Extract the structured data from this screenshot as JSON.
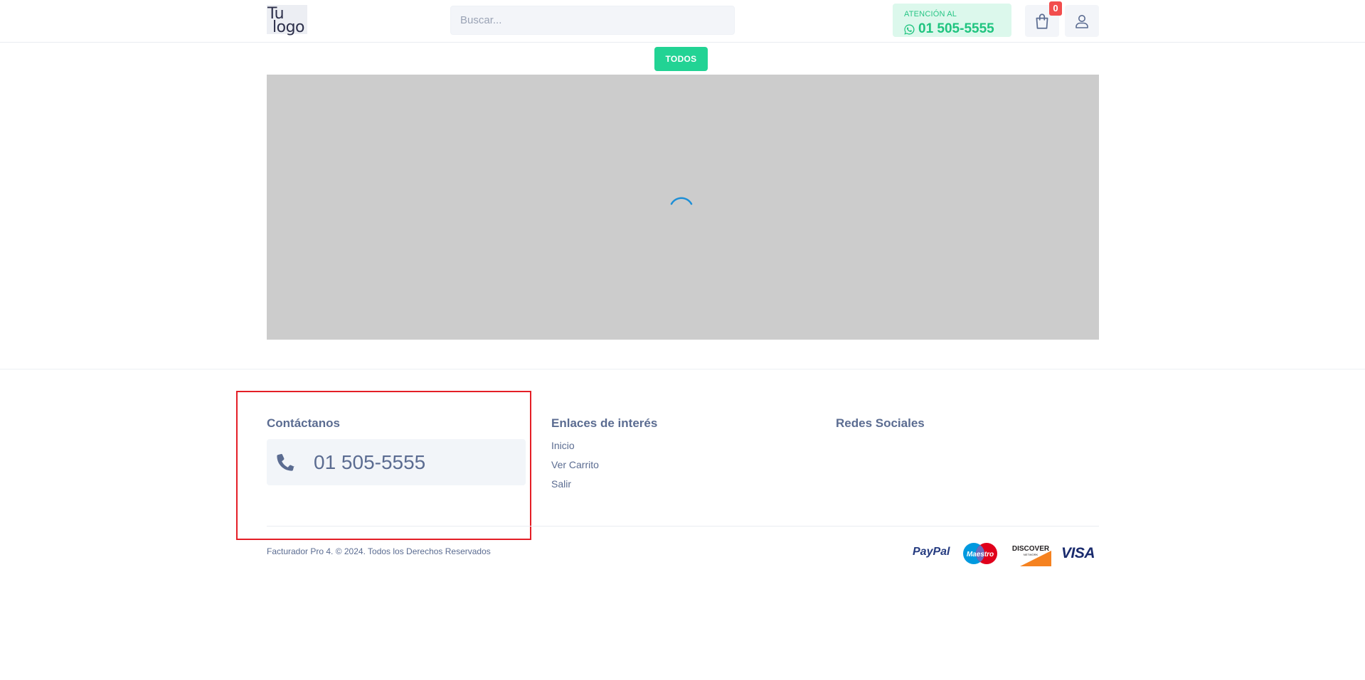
{
  "header": {
    "logo_line1": "Tu",
    "logo_line2": "logo",
    "search_placeholder": "Buscar...",
    "attention_caption": "ATENCIÓN AL",
    "attention_phone": "01 505-5555",
    "cart_count": "0",
    "icons": [
      "whatsapp-icon",
      "shopping-bag-icon",
      "user-icon"
    ]
  },
  "categories": {
    "todos_label": "TODOS"
  },
  "banner": {
    "state": "loading",
    "background": "#cccccc",
    "spinner_color": "#1e8fd6"
  },
  "footer": {
    "contact": {
      "heading": "Contáctanos",
      "phone": "01 505-5555",
      "icon": "phone-icon"
    },
    "links": {
      "heading": "Enlaces de interés",
      "items": [
        "Inicio",
        "Ver Carrito",
        "Salir"
      ]
    },
    "social": {
      "heading": "Redes Sociales"
    },
    "copyright": "Facturador Pro 4. © 2024. Todos los Derechos Reservados",
    "payments": {
      "paypal": "PayPal",
      "maestro": "Maestro",
      "discover": "DISCOVER",
      "discover_sub": "NETWORK",
      "visa": "VISA"
    }
  },
  "colors": {
    "accent": "#22d394",
    "text": "#5b6c91",
    "badge": "#f24d4d",
    "highlight": "#e41e26"
  }
}
